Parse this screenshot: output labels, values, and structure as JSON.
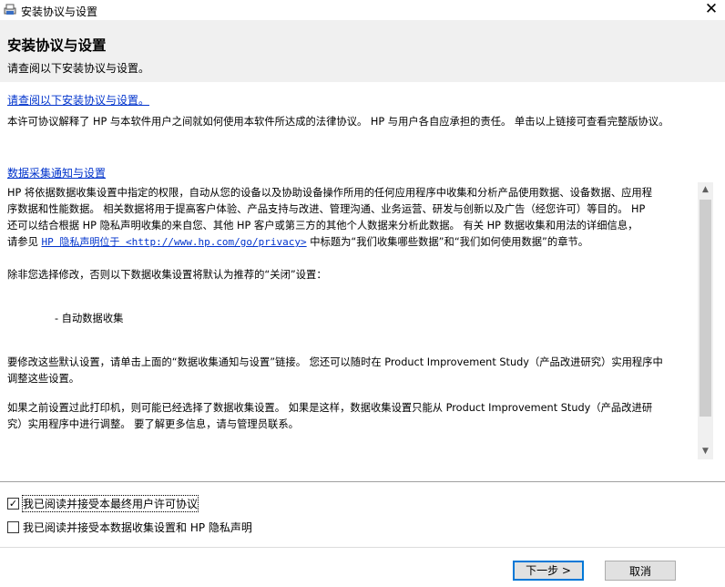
{
  "window": {
    "title": "安装协议与设置"
  },
  "header": {
    "title": "安装协议与设置",
    "subtitle": "请查阅以下安装协议与设置。"
  },
  "license": {
    "link_text": "请查阅以下安装协议与设置。",
    "description": "本许可协议解释了 HP 与本软件用户之间就如何使用本软件所达成的法律协议。 HP 与用户各自应承担的责任。 单击以上链接可查看完整版协议。"
  },
  "data_collection": {
    "link_text": "数据采集通知与设置",
    "p1_lines": [
      "HP 将依据数据收集设置中指定的权限，自动从您的设备以及协助设备操作所用的任何应用程序中收集和分析产品使用数据、设备数据、应用程",
      "序数据和性能数据。 相关数据将用于提高客户体验、产品支持与改进、管理沟通、业务运营、研发与创新以及广告（经您许可）等目的。 HP",
      "还可以结合根据 HP 隐私声明收集的来自您、其他 HP 客户或第三方的其他个人数据来分析此数据。 有关 HP 数据收集和用法的详细信息，"
    ],
    "p1_tail_prefix": "请参见 ",
    "p1_privacy_link": "HP 隐私声明位于 <http://www.hp.com/go/privacy>",
    "p1_tail_suffix": " 中标题为“我们收集哪些数据”和“我们如何使用数据”的章节。",
    "p2": "除非您选择修改，否则以下数据收集设置将默认为推荐的“关闭”设置：",
    "p3": "- 自动数据收集",
    "p4_lines": [
      "要修改这些默认设置，请单击上面的“数据收集通知与设置”链接。  您还可以随时在 Product Improvement Study（产品改进研究）实用程序中",
      "调整这些设置。"
    ],
    "p5_lines": [
      "如果之前设置过此打印机，则可能已经选择了数据收集设置。  如果是这样，数据收集设置只能从 Product Improvement Study（产品改进研",
      "究）实用程序中进行调整。  要了解更多信息，请与管理员联系。"
    ]
  },
  "checkboxes": {
    "eula": {
      "label": "我已阅读并接受本最终用户许可协议",
      "checked": true,
      "mark": "✓"
    },
    "privacy": {
      "label": "我已阅读并接受本数据收集设置和 HP 隐私声明",
      "checked": false
    }
  },
  "buttons": {
    "next": "下一步 >",
    "cancel": "取消"
  },
  "icons": {
    "close": "✕",
    "scroll_up": "▲",
    "scroll_down": "▼"
  }
}
